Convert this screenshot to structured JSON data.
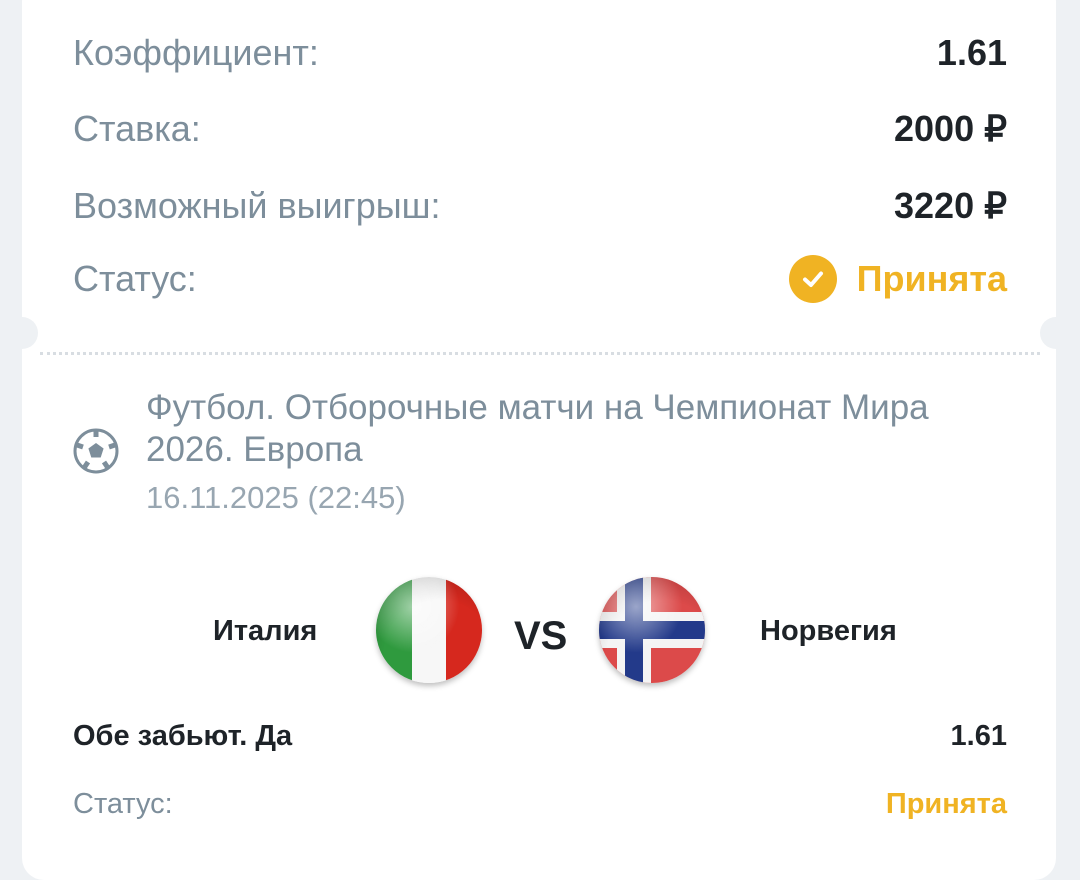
{
  "summary": {
    "coef_label": "Коэффициент:",
    "coef_value": "1.61",
    "stake_label": "Ставка:",
    "stake_value": "2000 ₽",
    "win_label": "Возможный выигрыш:",
    "win_value": "3220 ₽",
    "status_label": "Статус:",
    "status_value": "Принята",
    "status_icon": "check-circle-icon",
    "status_color": "#f0b323"
  },
  "event": {
    "sport_icon": "soccer-ball-icon",
    "league": "Футбол. Отборочные матчи на Чемпионат Мира 2026. Европа",
    "datetime": "16.11.2025 (22:45)",
    "home_team": "Италия",
    "home_flag": "italy-flag-icon",
    "vs_label": "VS",
    "away_team": "Норвегия",
    "away_flag": "norway-flag-icon",
    "market": "Обе забьют. Да",
    "market_odd": "1.61",
    "status_label": "Статус:",
    "status_value": "Принята"
  }
}
